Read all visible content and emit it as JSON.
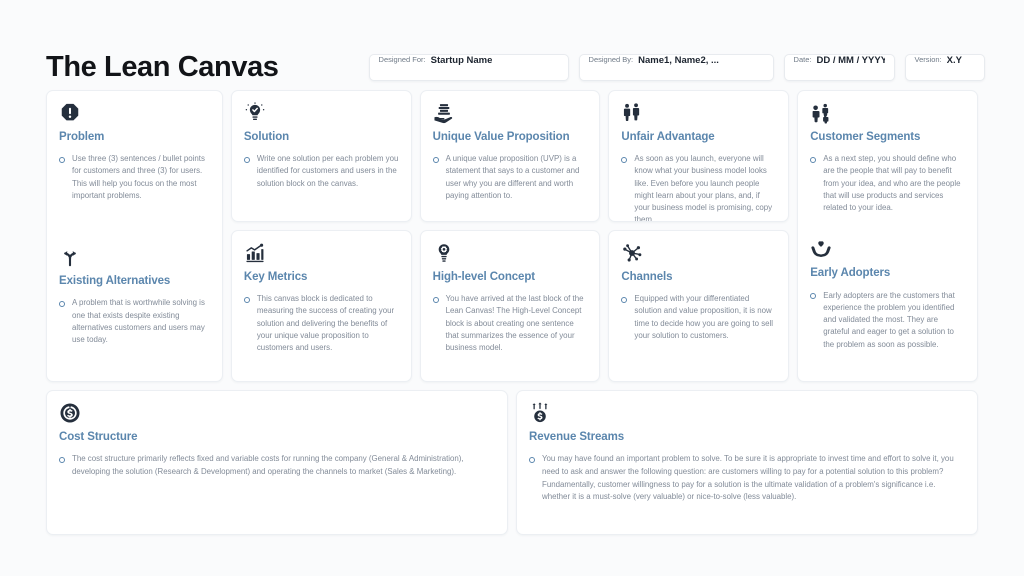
{
  "title": "The Lean Canvas",
  "theme": {
    "page_background": "#fafbfc",
    "card_background": "#ffffff",
    "heading_color": "#5b86ad",
    "body_text_color": "#828b98",
    "icon_color": "#252f3d",
    "title_color": "#121418"
  },
  "header_fields": [
    {
      "label": "Designed For:",
      "value": "Startup Name"
    },
    {
      "label": "Designed By:",
      "value": "Name1, Name2, ..."
    },
    {
      "label": "Date:",
      "value": "DD / MM / YYYY"
    },
    {
      "label": "Version:",
      "value": "X.Y"
    }
  ],
  "blocks": {
    "problem": {
      "icon": "exclamation-octagon-icon",
      "title": "Problem",
      "text": "Use three (3) sentences / bullet points for customers and three (3) for users. This will help you focus on the most important problems."
    },
    "existing_alternatives": {
      "icon": "branching-arrows-icon",
      "title": "Existing Alternatives",
      "text": "A problem that is worthwhile solving is one that exists despite existing alternatives customers and users may use today."
    },
    "solution": {
      "icon": "lightbulb-check-icon",
      "title": "Solution",
      "text": "Write one solution per each problem you identified for customers and users in the solution block on the canvas."
    },
    "key_metrics": {
      "icon": "bar-chart-growth-icon",
      "title": "Key Metrics",
      "text": "This canvas block is dedicated to measuring the success of creating your solution and delivering the benefits of your unique value proposition to customers and users."
    },
    "unique_value_proposition": {
      "icon": "hand-holding-money-icon",
      "title": "Unique Value Proposition",
      "text": "A unique value proposition (UVP) is a statement that says to a customer and user why you are different and worth paying attention to."
    },
    "high_level_concept": {
      "icon": "lightbulb-gear-icon",
      "title": "High-level Concept",
      "text": "You have arrived at the last block of the Lean Canvas! The High-Level Concept block is about creating one sentence that summarizes the essence of your business model."
    },
    "unfair_advantage": {
      "icon": "two-people-icon",
      "title": "Unfair Advantage",
      "text": "As soon as you launch, everyone will know what your business model looks like. Even before you launch people might learn about your plans, and, if your business model is promising, copy them."
    },
    "channels": {
      "icon": "network-hub-icon",
      "title": "Channels",
      "text": "Equipped with your differentiated solution and value proposition, it is now time to decide how you are going to sell your solution to customers."
    },
    "customer_segments": {
      "icon": "crowd-people-icon",
      "title": "Customer Segments",
      "text": "As a next step, you should define who are the people that will pay to benefit from your idea, and who are the people that will use products and services related to your idea."
    },
    "early_adopters": {
      "icon": "hands-holding-heart-icon",
      "title": "Early Adopters",
      "text": "Early adopters are the customers that experience the problem you identified and validated the most. They are grateful and eager to get a solution to the problem as soon as possible."
    },
    "cost_structure": {
      "icon": "dollar-circle-chart-icon",
      "title": "Cost Structure",
      "text": "The cost structure primarily reflects fixed and variable costs for running the company (General & Administration), developing the solution (Research & Development) and operating the channels to market (Sales & Marketing)."
    },
    "revenue_streams": {
      "icon": "money-growth-icon",
      "title": "Revenue Streams",
      "text": "You may have found an important problem to solve. To be sure it is appropriate to invest time and effort to solve it, you need to ask and answer the following question: are customers willing to pay for a potential solution to this problem? Fundamentally, customer willingness to pay for a solution is the ultimate validation of a problem's significance i.e. whether it is a must-solve (very valuable) or nice-to-solve (less valuable)."
    }
  }
}
